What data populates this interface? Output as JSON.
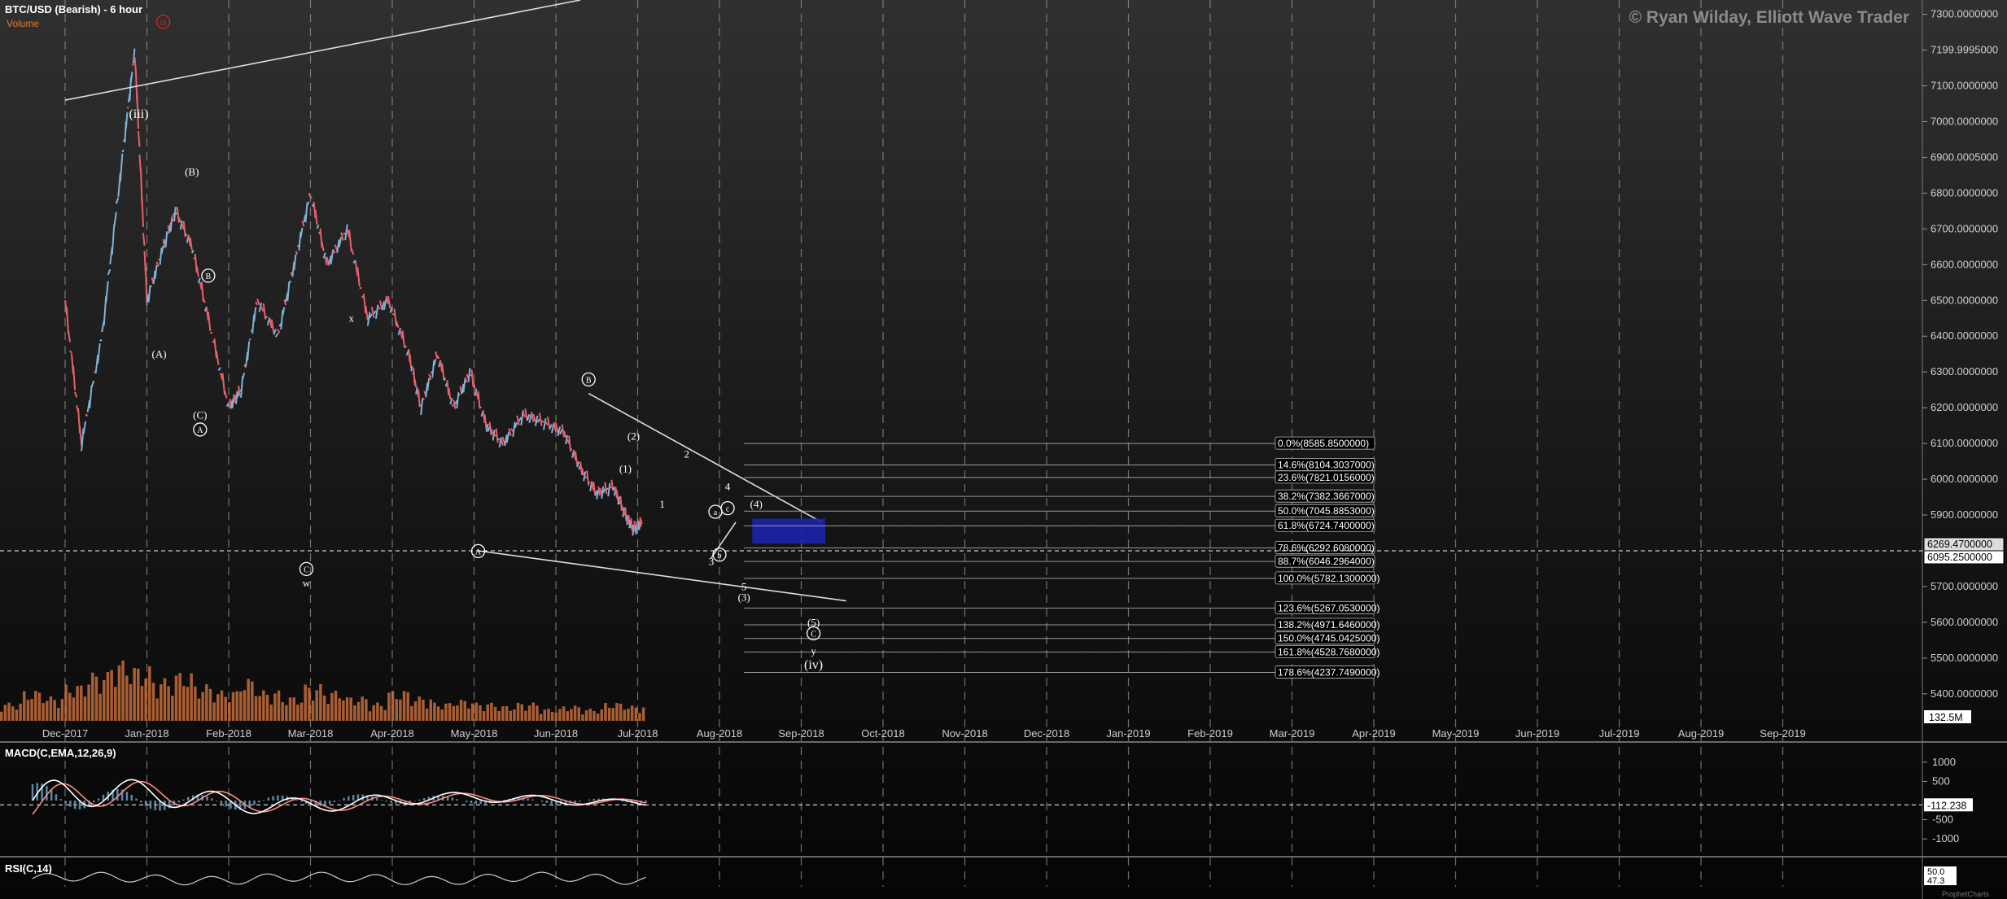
{
  "header": {
    "title": "BTC/USD (Bearish) - 6 hour",
    "volume_label": "Volume",
    "copyright": "© Ryan Wilday, Elliott Wave Trader"
  },
  "colors": {
    "up": "#7fb2d8",
    "down": "#e8606a",
    "volume": "#e07a40",
    "zone": "#1a24a8",
    "fib_line": "#bbbbbb",
    "wave_label": "#ffffff",
    "macd": "#ffffff",
    "signal": "#ff8a80",
    "hist": "#6a9ec2"
  },
  "chart_data": [
    {
      "type": "candlestick",
      "title": "BTC/USD (Bearish) - 6 hour",
      "x_ticks": [
        "Dec-2017",
        "Jan-2018",
        "Feb-2018",
        "Mar-2018",
        "Apr-2018",
        "May-2018",
        "Jun-2018",
        "Jul-2018",
        "Aug-2018",
        "Sep-2018",
        "Oct-2018",
        "Nov-2018",
        "Dec-2018",
        "Jan-2019",
        "Feb-2019",
        "Mar-2019",
        "Apr-2019",
        "May-2019",
        "Jun-2019",
        "Jul-2019",
        "Aug-2019",
        "Sep-2019"
      ],
      "y_ticks": [
        "7300.0000000",
        "7199.9995000",
        "7100.0000000",
        "7000.0000000",
        "6900.0005000",
        "6800.0000000",
        "6700.0000000",
        "6600.0000000",
        "6500.0000000",
        "6400.0000000",
        "6300.0000000",
        "6200.0000000",
        "6100.0000000",
        "6000.0000000",
        "5900.0000000",
        "5800.0000000",
        "5700.0000000",
        "5600.0000000",
        "5500.0000000",
        "5400.0000000"
      ],
      "ylim": [
        5320,
        7340
      ],
      "price_series": [
        [
          0.0,
          6500
        ],
        [
          0.2,
          6100
        ],
        [
          0.45,
          6400
        ],
        [
          0.7,
          6900
        ],
        [
          0.85,
          7200
        ],
        [
          1.0,
          6500
        ],
        [
          1.2,
          6650
        ],
        [
          1.35,
          6750
        ],
        [
          1.55,
          6650
        ],
        [
          1.75,
          6450
        ],
        [
          2.0,
          6200
        ],
        [
          2.15,
          6250
        ],
        [
          2.35,
          6500
        ],
        [
          2.6,
          6400
        ],
        [
          2.8,
          6600
        ],
        [
          3.0,
          6800
        ],
        [
          3.2,
          6600
        ],
        [
          3.45,
          6700
        ],
        [
          3.7,
          6450
        ],
        [
          3.95,
          6500
        ],
        [
          4.2,
          6350
        ],
        [
          4.35,
          6200
        ],
        [
          4.55,
          6350
        ],
        [
          4.75,
          6200
        ],
        [
          4.95,
          6300
        ],
        [
          5.15,
          6150
        ],
        [
          5.35,
          6100
        ],
        [
          5.6,
          6180
        ],
        [
          5.85,
          6160
        ],
        [
          6.1,
          6130
        ],
        [
          6.3,
          6030
        ],
        [
          6.5,
          5960
        ],
        [
          6.7,
          5980
        ],
        [
          6.85,
          5900
        ],
        [
          6.95,
          5860
        ],
        [
          7.05,
          5880
        ]
      ],
      "volume_profile": [
        0.3,
        0.5,
        0.4,
        0.6,
        0.8,
        1.0,
        0.9,
        0.7,
        0.8,
        0.6,
        0.5,
        0.7,
        0.5,
        0.4,
        0.6,
        0.5,
        0.4,
        0.3,
        0.5,
        0.4,
        0.3,
        0.35,
        0.3,
        0.25,
        0.3,
        0.2,
        0.25,
        0.2,
        0.3,
        0.25
      ],
      "current_prices": [
        "6269.4700000",
        "6095.2500000"
      ],
      "volume_readout": "132.5M",
      "fib_levels": [
        {
          "label": "0.0%(8585.8500000)",
          "price": 6100
        },
        {
          "label": "14.6%(8104.3037000)",
          "price": 6040
        },
        {
          "label": "23.6%(7821.0156000)",
          "price": 6005
        },
        {
          "label": "38.2%(7382.3667000)",
          "price": 5952
        },
        {
          "label": "50.0%(7045.8853000)",
          "price": 5911
        },
        {
          "label": "61.8%(6724.7400000)",
          "price": 5870
        },
        {
          "label": "78.6%(6292.6080000)",
          "price": 5808
        },
        {
          "label": "88.7%(6046.2964000)",
          "price": 5770
        },
        {
          "label": "100.0%(5782.1300000)",
          "price": 5723
        },
        {
          "label": "123.6%(5267.0530000)",
          "price": 5640
        },
        {
          "label": "138.2%(4971.6460000)",
          "price": 5593
        },
        {
          "label": "150.0%(4745.0425000)",
          "price": 5555
        },
        {
          "label": "161.8%(4528.7680000)",
          "price": 5517
        },
        {
          "label": "178.6%(4237.7490000)",
          "price": 5460
        }
      ],
      "wave_labels": [
        {
          "text": "(iii)",
          "m": 0.9,
          "price": 7010
        },
        {
          "text": "iii",
          "m": 1.2,
          "price": 7270,
          "circle": true,
          "color": "#d22"
        },
        {
          "text": "(B)",
          "m": 1.55,
          "price": 6850
        },
        {
          "text": "B",
          "m": 1.75,
          "price": 6560,
          "circle": true
        },
        {
          "text": "(A)",
          "m": 1.15,
          "price": 6340
        },
        {
          "text": "(C)",
          "m": 1.65,
          "price": 6170
        },
        {
          "text": "A",
          "m": 1.65,
          "price": 6130,
          "circle": true
        },
        {
          "text": "C",
          "m": 2.95,
          "price": 5740,
          "circle": true
        },
        {
          "text": "w",
          "m": 2.95,
          "price": 5700
        },
        {
          "text": "x",
          "m": 3.5,
          "price": 6440
        },
        {
          "text": "A",
          "m": 5.05,
          "price": 5790,
          "circle": true
        },
        {
          "text": "B",
          "m": 6.4,
          "price": 6270,
          "circle": true
        },
        {
          "text": "(2)",
          "m": 6.95,
          "price": 6110
        },
        {
          "text": "(1)",
          "m": 6.85,
          "price": 6020
        },
        {
          "text": "2",
          "m": 7.6,
          "price": 6060
        },
        {
          "text": "1",
          "m": 7.3,
          "price": 5920
        },
        {
          "text": "4",
          "m": 8.1,
          "price": 5970
        },
        {
          "text": "(4)",
          "m": 8.45,
          "price": 5920
        },
        {
          "text": "a",
          "m": 7.95,
          "price": 5900,
          "circle": true
        },
        {
          "text": "c",
          "m": 8.1,
          "price": 5910,
          "circle": true
        },
        {
          "text": "b",
          "m": 8.0,
          "price": 5780,
          "circle": true
        },
        {
          "text": "3",
          "m": 7.9,
          "price": 5760
        },
        {
          "text": "5",
          "m": 8.3,
          "price": 5690
        },
        {
          "text": "(3)",
          "m": 8.3,
          "price": 5660
        },
        {
          "text": "(5)",
          "m": 9.15,
          "price": 5590
        },
        {
          "text": "C",
          "m": 9.15,
          "price": 5560,
          "circle": true
        },
        {
          "text": "y",
          "m": 9.15,
          "price": 5510
        },
        {
          "text": "(iv)",
          "m": 9.15,
          "price": 5470
        }
      ],
      "trendlines": [
        {
          "from": [
            0.0,
            7060
          ],
          "to": [
            6.3,
            7340
          ]
        },
        {
          "from": [
            6.4,
            6240
          ],
          "to": [
            9.25,
            5880
          ]
        },
        {
          "from": [
            5.05,
            5800
          ],
          "to": [
            9.55,
            5660
          ]
        },
        {
          "from": [
            7.9,
            5780
          ],
          "to": [
            8.2,
            5880
          ]
        }
      ]
    },
    {
      "type": "line",
      "title": "MACD(C,EMA,12,26,9)",
      "y_ticks": [
        "1000",
        "500",
        "-500",
        "-1000"
      ],
      "current_value": "-112.238",
      "ylim": [
        -1400,
        1400
      ]
    },
    {
      "type": "line",
      "title": "RSI(C,14)",
      "current_values": [
        "50.0",
        "47.3"
      ]
    }
  ],
  "footer": {
    "watermark": "ProphetCharts"
  }
}
